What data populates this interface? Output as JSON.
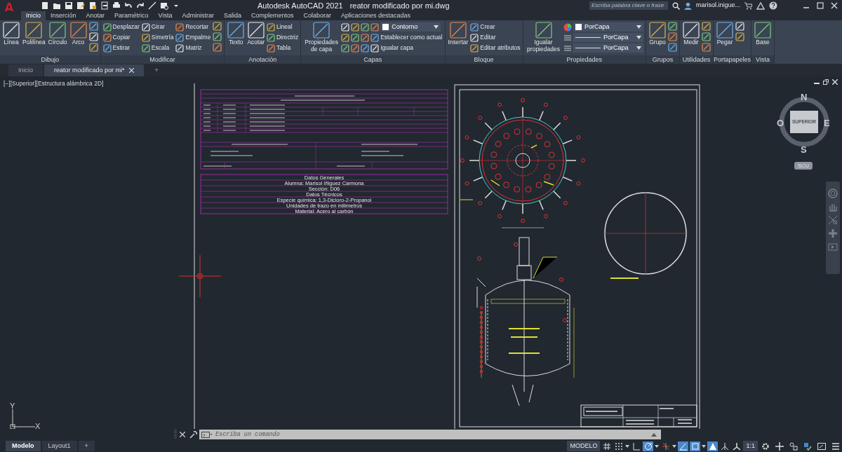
{
  "app": {
    "logo": "A",
    "title": "Autodesk AutoCAD 2021",
    "file": "reator modificado por mi.dwg"
  },
  "search": {
    "placeholder": "Escriba palabra clave o frase"
  },
  "user": "marisol.inigue...",
  "ribbon_tabs": [
    {
      "label": "Inicio",
      "selected": true
    },
    {
      "label": "Inserción",
      "selected": false
    },
    {
      "label": "Anotar",
      "selected": false
    },
    {
      "label": "Paramétrico",
      "selected": false
    },
    {
      "label": "Vista",
      "selected": false
    },
    {
      "label": "Administrar",
      "selected": false
    },
    {
      "label": "Salida",
      "selected": false
    },
    {
      "label": "Complementos",
      "selected": false
    },
    {
      "label": "Colaborar",
      "selected": false
    },
    {
      "label": "Aplicaciones destacadas",
      "selected": false
    }
  ],
  "panels": [
    {
      "title": "Dibujo",
      "tools": [
        {
          "kind": "large",
          "label": "Línea"
        },
        {
          "kind": "large",
          "label": "Polilínea"
        },
        {
          "kind": "large",
          "label": "Círculo"
        },
        {
          "kind": "large",
          "label": "Arco"
        },
        {
          "kind": "icon"
        },
        {
          "kind": "icon"
        },
        {
          "kind": "icon"
        }
      ]
    },
    {
      "title": "Modificar",
      "tools": [
        {
          "kind": "small",
          "label": "Desplazar"
        },
        {
          "kind": "small",
          "label": "Copiar"
        },
        {
          "kind": "small",
          "label": "Estirar"
        },
        {
          "kind": "small",
          "label": "Girar"
        },
        {
          "kind": "small",
          "label": "Simetría"
        },
        {
          "kind": "small",
          "label": "Escala"
        },
        {
          "kind": "small",
          "label": "Recortar"
        },
        {
          "kind": "small",
          "label": "Empalme"
        },
        {
          "kind": "small",
          "label": "Matriz"
        },
        {
          "kind": "icon"
        },
        {
          "kind": "icon"
        },
        {
          "kind": "icon"
        }
      ]
    },
    {
      "title": "Anotación",
      "tools": [
        {
          "kind": "large",
          "label": "Texto"
        },
        {
          "kind": "large",
          "label": "Acotar"
        },
        {
          "kind": "small",
          "label": "Lineal"
        },
        {
          "kind": "small",
          "label": "Directriz"
        },
        {
          "kind": "small",
          "label": "Tabla"
        }
      ]
    },
    {
      "title": "Capas",
      "tools": [
        {
          "kind": "large",
          "label": "Propiedades de capa"
        },
        {
          "kind": "layer-dropdown",
          "label": "Contorno"
        },
        {
          "kind": "layer-row",
          "label": "Establecer como actual"
        },
        {
          "kind": "layer-row",
          "label": "Igualar capa"
        }
      ]
    },
    {
      "title": "Bloque",
      "tools": [
        {
          "kind": "large",
          "label": "Insertar"
        },
        {
          "kind": "small",
          "label": "Crear"
        },
        {
          "kind": "small",
          "label": "Editar"
        },
        {
          "kind": "small",
          "label": "Editar atributos"
        }
      ]
    },
    {
      "title": "Propiedades",
      "tools": [
        {
          "kind": "large",
          "label": "Igualar propiedades"
        },
        {
          "kind": "color-dropdown",
          "label": "PorCapa"
        },
        {
          "kind": "line-dropdown",
          "label": "PorCapa"
        },
        {
          "kind": "line-dropdown",
          "label": "PorCapa"
        }
      ]
    },
    {
      "title": "Grupos",
      "tools": [
        {
          "kind": "large",
          "label": "Grupo"
        },
        {
          "kind": "icon"
        },
        {
          "kind": "icon"
        },
        {
          "kind": "icon"
        }
      ]
    },
    {
      "title": "Utilidades",
      "tools": [
        {
          "kind": "large",
          "label": "Medir"
        },
        {
          "kind": "icon"
        },
        {
          "kind": "icon"
        },
        {
          "kind": "icon"
        }
      ]
    },
    {
      "title": "Portapapeles",
      "tools": [
        {
          "kind": "large",
          "label": "Pegar"
        },
        {
          "kind": "icon"
        },
        {
          "kind": "icon"
        }
      ]
    },
    {
      "title": "Vista",
      "tools": [
        {
          "kind": "large",
          "label": "Base"
        }
      ]
    }
  ],
  "doc_tabs": [
    {
      "label": "Inicio",
      "selected": false
    },
    {
      "label": "reator modificado por mi*",
      "selected": true
    }
  ],
  "new_tab": "+",
  "viewport_label": "[−][Superior][Estructura alámbrica 2D]",
  "viewcube": {
    "north": "N",
    "west": "O",
    "east": "E",
    "south": "S",
    "face": "SUPERIOR",
    "ucs": "SCU"
  },
  "sheet_table": [
    "Datos Generales",
    "Alumna: Marisol Iñiguez Carmona",
    "Sección: D06",
    "Datos Técnicos",
    "Especie química: 1,3-Dicloro-2-Propanol",
    "Unidades de trazo en milímetros",
    "Material: Acero al carbón"
  ],
  "ucs": {
    "x": "X",
    "y": "Y"
  },
  "command": {
    "placeholder": "Escriba un comando"
  },
  "layout_tabs": [
    {
      "label": "Modelo",
      "selected": true
    },
    {
      "label": "Layout1",
      "selected": false
    }
  ],
  "new_layout": "+",
  "status": {
    "mode": "MODELO",
    "scale": "1:1",
    "toggles": [
      {
        "on": false
      },
      {
        "on": false
      },
      {
        "on": false
      },
      {
        "on": true
      },
      {
        "on": false
      },
      {
        "on": true
      },
      {
        "on": true
      },
      {
        "on": true
      },
      {
        "on": false
      },
      {
        "on": false
      }
    ]
  }
}
